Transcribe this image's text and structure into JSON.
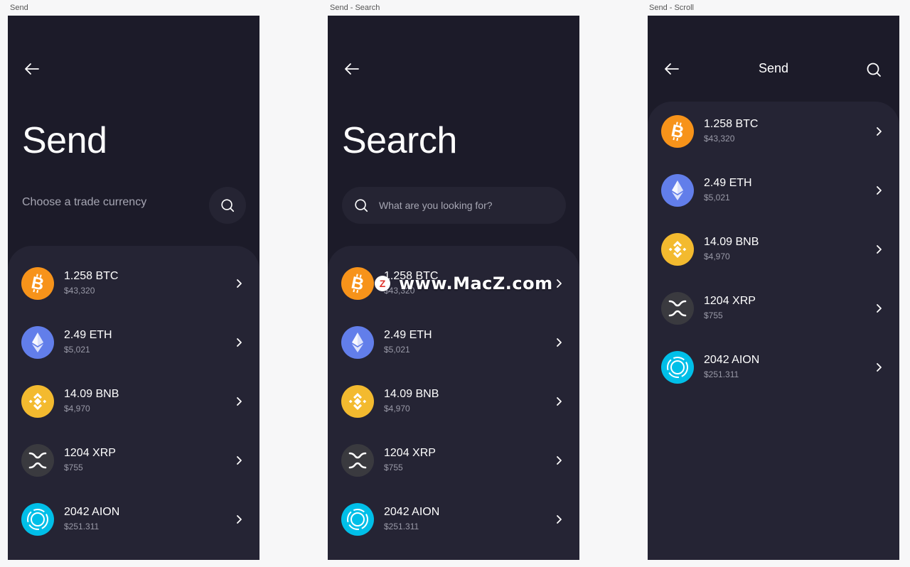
{
  "artboards": [
    {
      "label": "Send"
    },
    {
      "label": "Send - Search"
    },
    {
      "label": "Send - Scroll"
    }
  ],
  "send_screen": {
    "title": "Send",
    "choose_label": "Choose a trade currency"
  },
  "search_screen": {
    "title": "Search",
    "search_placeholder": "What are you looking for?"
  },
  "scroll_screen": {
    "header_title": "Send"
  },
  "coins": [
    {
      "amount": "1.258 BTC",
      "value": "$43,320",
      "icon": "bitcoin-icon",
      "color": "#f7931a"
    },
    {
      "amount": "2.49 ETH",
      "value": "$5,021",
      "icon": "ethereum-icon",
      "color": "#627eea"
    },
    {
      "amount": "14.09 BNB",
      "value": "$4,970",
      "icon": "binance-icon",
      "color": "#f3ba2f"
    },
    {
      "amount": "1204 XRP",
      "value": "$755",
      "icon": "xrp-icon",
      "color": "#3a3a3f"
    },
    {
      "amount": "2042 AION",
      "value": "$251.311",
      "icon": "aion-icon",
      "color": "#00bfe8"
    }
  ],
  "watermark": {
    "badge": "Z",
    "text": "www.MacZ.com"
  }
}
